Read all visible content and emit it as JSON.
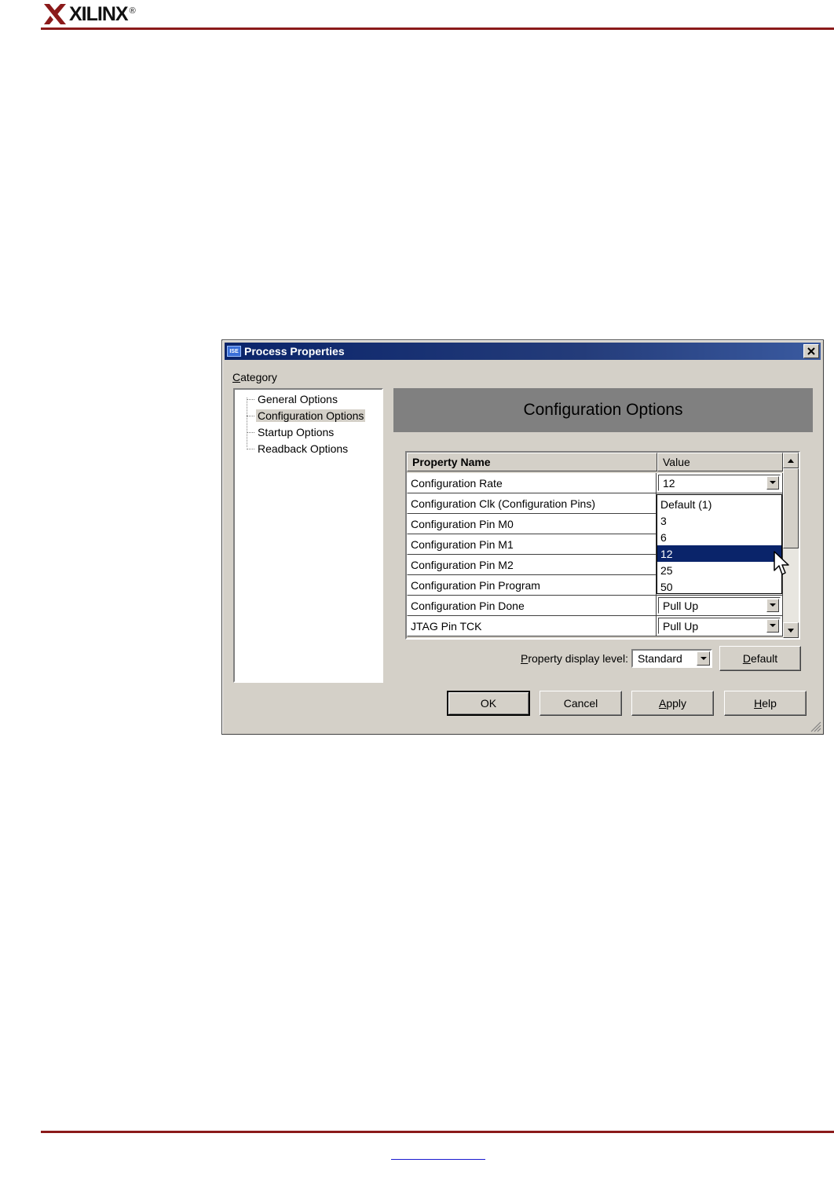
{
  "document": {
    "logo_text": "XILINX",
    "logo_mark": "®"
  },
  "dialog": {
    "title": "Process Properties",
    "app_icon_text": "ISE",
    "category_label_first": "C",
    "category_label_rest": "ategory",
    "tree": [
      {
        "label": "General Options",
        "selected": false
      },
      {
        "label": "Configuration Options",
        "selected": true
      },
      {
        "label": "Startup Options",
        "selected": false
      },
      {
        "label": "Readback Options",
        "selected": false
      }
    ],
    "panel_title": "Configuration Options",
    "grid": {
      "header_name": "Property Name",
      "header_value": "Value",
      "rows": [
        {
          "name": "Configuration Rate",
          "value": "12"
        },
        {
          "name": "Configuration Clk (Configuration Pins)",
          "value": ""
        },
        {
          "name": "Configuration Pin M0",
          "value": ""
        },
        {
          "name": "Configuration Pin M1",
          "value": ""
        },
        {
          "name": "Configuration Pin M2",
          "value": ""
        },
        {
          "name": "Configuration Pin Program",
          "value": ""
        },
        {
          "name": "Configuration Pin Done",
          "value": "Pull Up"
        },
        {
          "name": "JTAG Pin TCK",
          "value": "Pull Up"
        }
      ]
    },
    "dropdown": {
      "options": [
        "Default (1)",
        "3",
        "6",
        "12",
        "25",
        "50"
      ],
      "selected": "12"
    },
    "display_level": {
      "label_first": "P",
      "label_rest": "roperty display level:",
      "value": "Standard"
    },
    "buttons": {
      "default_first": "D",
      "default_rest": "efault",
      "ok": "OK",
      "cancel": "Cancel",
      "apply_first": "A",
      "apply_rest": "pply",
      "help_first": "H",
      "help_rest": "elp"
    }
  }
}
